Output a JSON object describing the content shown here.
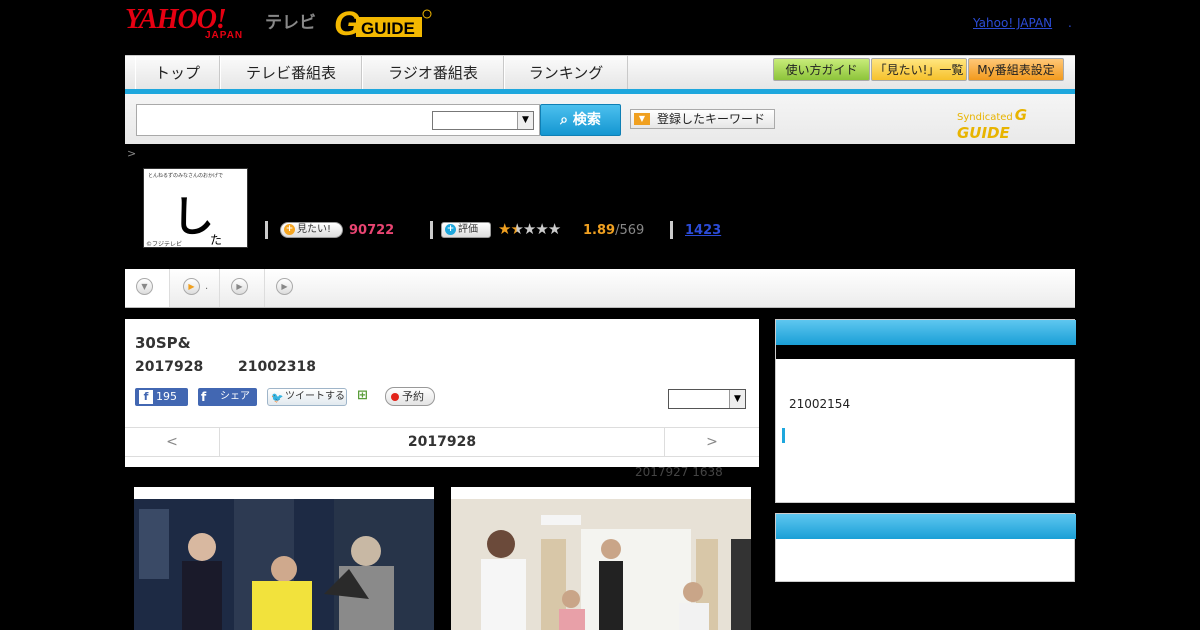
{
  "header": {
    "yahoo_logo": "YAHOO!",
    "yahoo_japan": "JAPAN",
    "tv_label": "テレビ",
    "gguide_logo": "G GUIDE",
    "yahoo_japan_link": "Yahoo! JAPAN",
    "separator": "."
  },
  "nav": {
    "tabs": [
      "トップ",
      "テレビ番組表",
      "ラジオ番組表",
      "ランキング"
    ],
    "buttons": [
      "使い方ガイド",
      "「見たい!」一覧",
      "My番組表設定"
    ],
    "accent_color": "#1ea7dd"
  },
  "search": {
    "button_label": "検索",
    "keyword_button": "登録したキーワード",
    "syndicated": "Syndicated"
  },
  "breadcrumb": ">",
  "program": {
    "thumbnail_caption": "とんねるずのみなさんのおかげで",
    "thumbnail_glyph": "し",
    "thumbnail_sub": "た",
    "thumbnail_copyright": "©フジテレビ",
    "want_label": "見たい!",
    "want_count": "90722",
    "rate_label": "評価",
    "rating_stars": 1.89,
    "rating": "1.89",
    "rating_count": "/569",
    "review_count": "1423"
  },
  "main": {
    "title": "30SP&",
    "date": "2017928",
    "program_id": "21002318",
    "like_count": "195",
    "share_label": "シェア",
    "tweet_label": "ツイートする",
    "reserve_label": "予約",
    "prev": "<",
    "current_date": "2017928",
    "next": ">",
    "updated": "2017927  1638"
  },
  "sidebar": {
    "number": "21002154"
  }
}
